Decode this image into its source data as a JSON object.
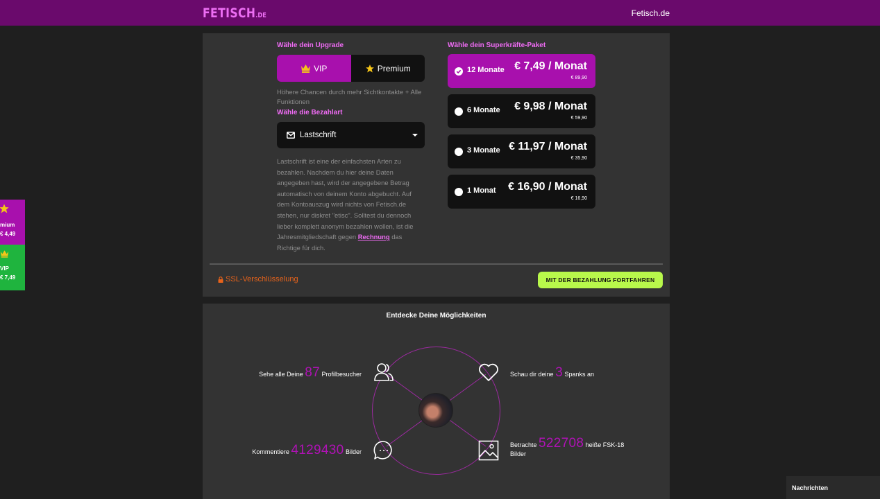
{
  "header": {
    "logo_main": "FETISCH",
    "logo_tld": ".DE",
    "link": "Fetisch.de"
  },
  "upgrade": {
    "title": "Wähle dein Upgrade",
    "options": [
      {
        "label": "VIP",
        "icon": "crown-icon",
        "selected": true
      },
      {
        "label": "Premium",
        "icon": "star-icon",
        "selected": false
      }
    ],
    "description": "Höhere Chancen durch mehr Sichtkontakte + Alle Funktionen"
  },
  "payment": {
    "title": "Wähle die Bezahlart",
    "selected": "Lastschrift",
    "description": "Lastschrift ist eine der einfachsten Arten zu bezahlen. Nachdem du hier deine Daten angegeben hast, wird der angegebene Betrag automatisch von deinem Konto abgebucht. Auf dem Kontoauszug wird nichts von Fetisch.de stehen, nur diskret \"etisc\". Solltest du dennoch lieber komplett anonym bezahlen wollen, ist die Jahresmitgliedschaft gegen",
    "link": "Rechnung",
    "description_end": "das Richtige für dich."
  },
  "packages": {
    "title": "Wähle dein Superkräfte-Paket",
    "items": [
      {
        "name": "12 Monate",
        "price": "€ 7,49 / Monat",
        "total": "€ 89,90",
        "selected": true
      },
      {
        "name": "6 Monate",
        "price": "€ 9,98 / Monat",
        "total": "€ 59,90",
        "selected": false
      },
      {
        "name": "3 Monate",
        "price": "€ 11,97 / Monat",
        "total": "€ 35,90",
        "selected": false
      },
      {
        "name": "1 Monat",
        "price": "€ 16,90 / Monat",
        "total": "€ 16,90",
        "selected": false
      }
    ]
  },
  "footer": {
    "ssl": "SSL-Verschlüsselung",
    "cta": "MIT DER BEZAHLUNG FORTFAHREN"
  },
  "discover": {
    "title": "Entdecke Deine Möglichkeiten",
    "visitors": {
      "pre": "Sehe alle Deine",
      "num": "87",
      "post": "Profilbesucher"
    },
    "spanks": {
      "pre": "Schau dir deine",
      "num": "3",
      "post": "Spanks an"
    },
    "comments": {
      "pre": "Kommentiere",
      "num": "4129430",
      "post": "Bilder"
    },
    "images": {
      "pre": "Betrachte",
      "num": "522708",
      "post": "heiße FSK-18",
      "post2": "Bilder"
    }
  },
  "side": {
    "premium": {
      "name": "mium",
      "price": "€ 4,49"
    },
    "vip": {
      "name": "VIP",
      "price": "€ 7,49"
    }
  },
  "messages": {
    "label": "Nachrichten"
  },
  "colors": {
    "brand": "#6a0a6c",
    "accent": "#a810ad",
    "pink": "#f06cf5",
    "cta": "#b8f84b",
    "vip_green": "#1fb43e",
    "ssl_orange": "#e8631b"
  }
}
